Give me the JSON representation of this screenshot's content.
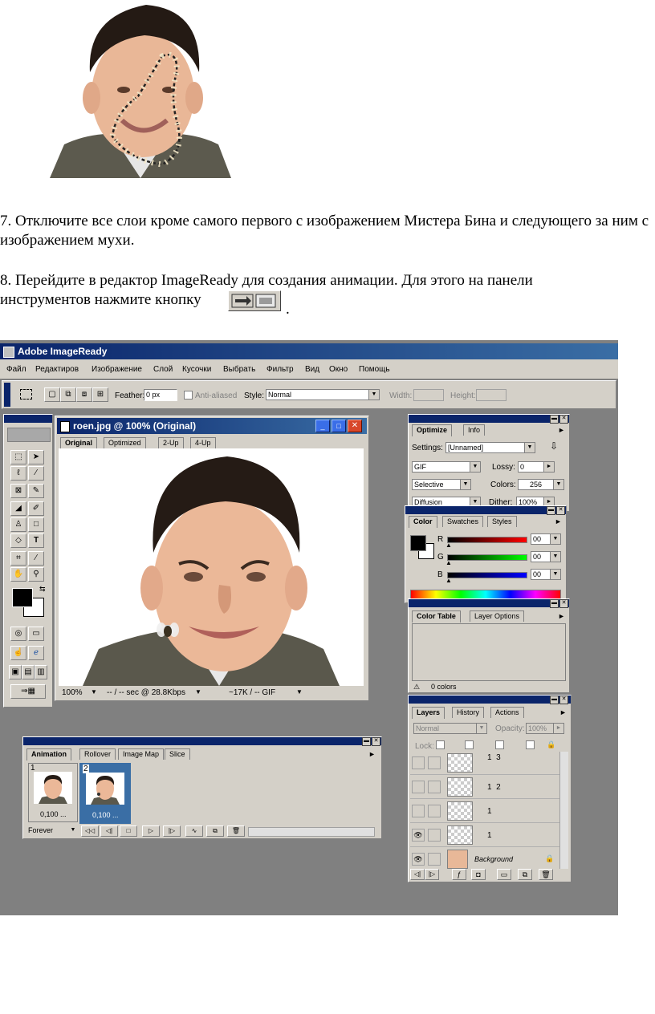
{
  "doc": {
    "step7": "7. Отключите все слои кроме самого первого с изображением Мистера Бина и следующего за ним с изображением мухи.",
    "step8": "8. Перейдите в редактор ImageReady для создания анимации. Для этого на панели инструментов нажмите кнопку",
    "step8_end": "."
  },
  "app": {
    "title": "Adobe ImageReady",
    "menu": [
      "Файл",
      "Редактиров",
      "Изображение",
      "Слой",
      "Кусочки",
      "Выбрать",
      "Фильтр",
      "Вид",
      "Окно",
      "Помощь"
    ],
    "options": {
      "feather_label": "Feather:",
      "feather_value": "0 px",
      "antialiased": "Anti-aliased",
      "style_label": "Style:",
      "style_value": "Normal",
      "width_label": "Width:",
      "height_label": "Height:"
    },
    "doc_window": {
      "title": "roen.jpg @ 100% (Original)",
      "tabs": [
        "Original",
        "Optimized",
        "2-Up",
        "4-Up"
      ],
      "zoom": "100%",
      "speed": "-- / -- sec @ 28.8Kbps",
      "size": "~17K / -- GIF"
    },
    "optimize": {
      "tabs": [
        "Optimize",
        "Info"
      ],
      "settings_label": "Settings:",
      "settings_value": "[Unnamed]",
      "format": "GIF",
      "lossy_label": "Lossy:",
      "lossy_value": "0",
      "palette": "Selective",
      "colors_label": "Colors:",
      "colors_value": "256",
      "dither_type": "Diffusion",
      "dither_label": "Dither:",
      "dither_value": "100%"
    },
    "color": {
      "tabs": [
        "Color",
        "Swatches",
        "Styles"
      ],
      "r_label": "R",
      "g_label": "G",
      "b_label": "B",
      "r_value": "00",
      "g_value": "00",
      "b_value": "00"
    },
    "color_table": {
      "tabs": [
        "Color Table",
        "Layer Options"
      ],
      "count": "0 colors"
    },
    "layers": {
      "tabs": [
        "Layers",
        "History",
        "Actions"
      ],
      "mode": "Normal",
      "opacity_label": "Opacity:",
      "opacity_value": "100%",
      "lock_label": "Lock:",
      "rows": [
        {
          "name": "1  3"
        },
        {
          "name": "1  2"
        },
        {
          "name": "1"
        },
        {
          "name": "1"
        },
        {
          "name": "Background"
        }
      ]
    },
    "animation": {
      "tabs": [
        "Animation",
        "Rollover",
        "Image Map",
        "Slice"
      ],
      "frames": [
        {
          "num": "1",
          "delay": "0,100 ..."
        },
        {
          "num": "2",
          "delay": "0,100 ..."
        }
      ],
      "loop": "Forever"
    }
  }
}
